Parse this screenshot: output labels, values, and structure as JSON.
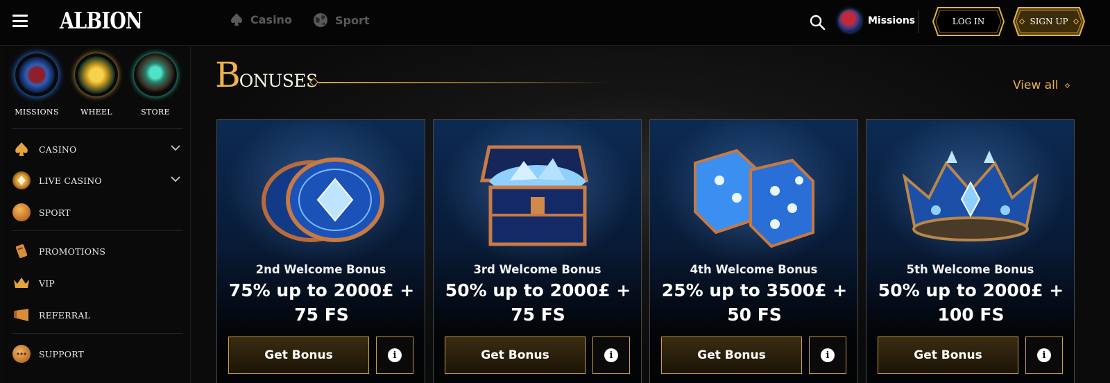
{
  "header": {
    "logo": "ALBION",
    "nav": [
      {
        "label": "Casino",
        "icon": "spade-icon"
      },
      {
        "label": "Sport",
        "icon": "globe-ball-icon"
      }
    ],
    "missions_label": "Missions",
    "login_label": "LOG IN",
    "signup_label": "SIGN UP"
  },
  "sidebar": {
    "quick_links": [
      {
        "label": "MISSIONS",
        "icon": "missions-gem-icon"
      },
      {
        "label": "WHEEL",
        "icon": "wheel-gem-icon"
      },
      {
        "label": "STORE",
        "icon": "store-chest-icon"
      }
    ],
    "items": [
      {
        "label": "CASINO",
        "icon": "spade-icon",
        "expandable": true
      },
      {
        "label": "LIVE CASINO",
        "icon": "live-casino-icon",
        "expandable": true
      },
      {
        "label": "SPORT",
        "icon": "sport-ball-icon",
        "expandable": false
      },
      {
        "label": "PROMOTIONS",
        "icon": "scroll-icon",
        "expandable": false
      },
      {
        "label": "VIP",
        "icon": "crown-icon",
        "expandable": false
      },
      {
        "label": "REFERRAL",
        "icon": "horn-icon",
        "expandable": false
      },
      {
        "label": "SUPPORT",
        "icon": "chat-bubble-icon",
        "expandable": false
      }
    ]
  },
  "main": {
    "section_title_initial": "B",
    "section_title_rest": "ONUSES",
    "view_all_label": "View all",
    "cards": [
      {
        "subtitle": "2nd Welcome Bonus",
        "offer": "75% up to 2000£ + 75 FS",
        "button": "Get Bonus",
        "art": "coins-icon"
      },
      {
        "subtitle": "3rd Welcome Bonus",
        "offer": "50% up to 2000£ + 75 FS",
        "button": "Get Bonus",
        "art": "treasure-chest-icon"
      },
      {
        "subtitle": "4th Welcome Bonus",
        "offer": "25% up to 3500£ + 50 FS",
        "button": "Get Bonus",
        "art": "dice-icon"
      },
      {
        "subtitle": "5th Welcome Bonus",
        "offer": "50% up to 2000£ + 100 FS",
        "button": "Get Bonus",
        "art": "crown-icon"
      }
    ]
  },
  "colors": {
    "accent_gold": "#efb04c",
    "background": "#0b0b0c",
    "card_blue": "#0c2a52"
  }
}
